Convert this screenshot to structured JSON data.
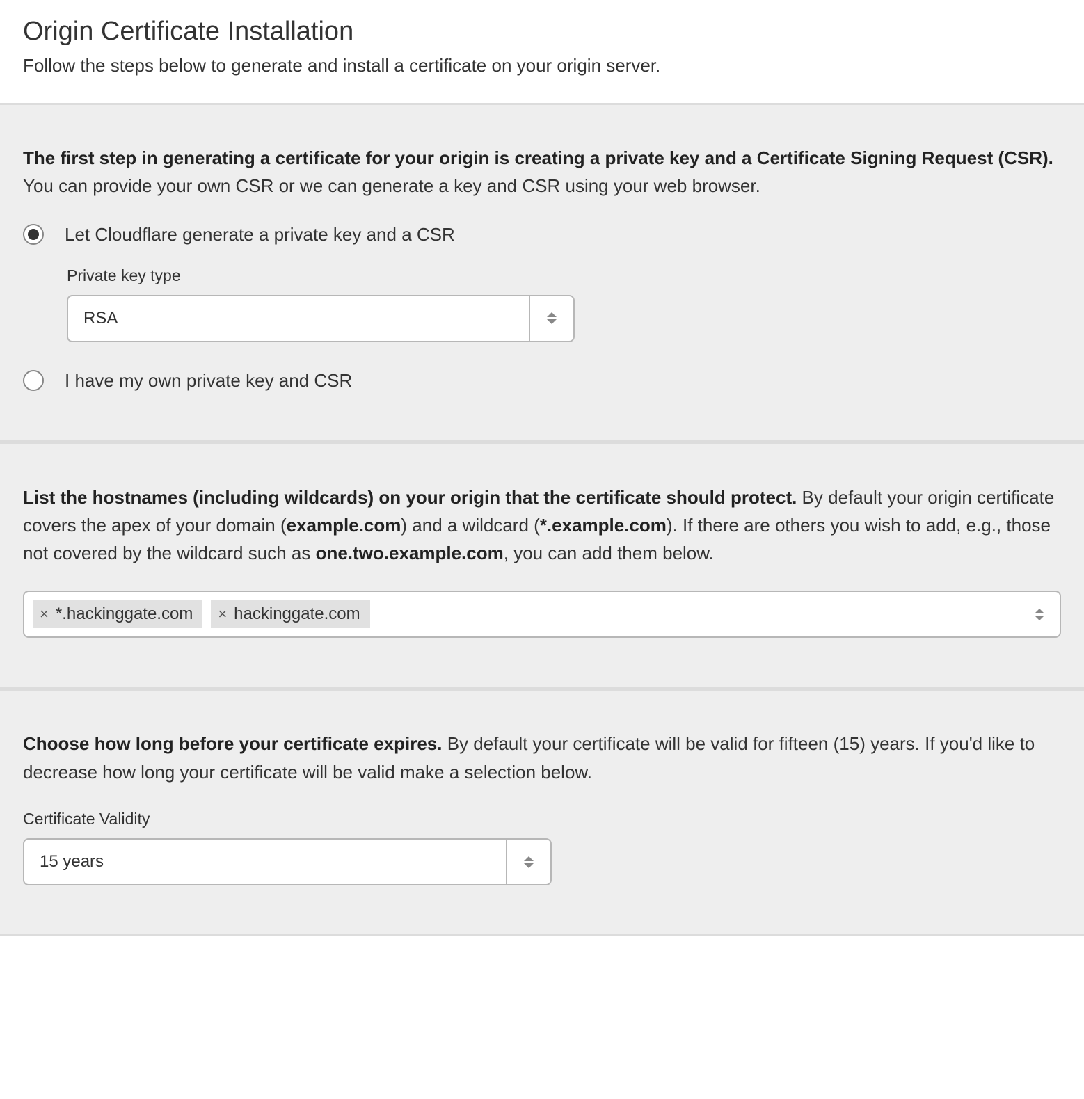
{
  "header": {
    "title": "Origin Certificate Installation",
    "subtitle": "Follow the steps below to generate and install a certificate on your origin server."
  },
  "step1": {
    "intro_bold": "The first step in generating a certificate for your origin is creating a private key and a Certificate Signing Request (CSR).",
    "intro_rest": " You can provide your own CSR or we can generate a key and CSR using your web browser.",
    "option_generate": "Let Cloudflare generate a private key and a CSR",
    "private_key_type_label": "Private key type",
    "private_key_type_value": "RSA",
    "option_own": "I have my own private key and CSR"
  },
  "step2": {
    "intro_bold": "List the hostnames (including wildcards) on your origin that the certificate should protect.",
    "intro_seg1": " By default your origin certificate covers the apex of your domain (",
    "example_apex": "example.com",
    "intro_seg2": ") and a wildcard (",
    "example_wild": "*.example.com",
    "intro_seg3": "). If there are others you wish to add, e.g., those not covered by the wildcard such as ",
    "example_sub": "one.two.example.com",
    "intro_seg4": ", you can add them below.",
    "hostnames": [
      "*.hackinggate.com",
      "hackinggate.com"
    ],
    "remove_symbol": "×"
  },
  "step3": {
    "intro_bold": "Choose how long before your certificate expires.",
    "intro_rest": " By default your certificate will be valid for fifteen (15) years. If you'd like to decrease how long your certificate will be valid make a selection below.",
    "validity_label": "Certificate Validity",
    "validity_value": "15 years"
  }
}
